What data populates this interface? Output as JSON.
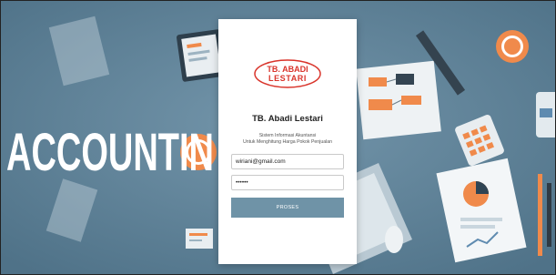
{
  "background": {
    "headline": "ACCOUNTIN",
    "colors": {
      "background": "#5f8399",
      "accent_orange": "#f08a4b"
    }
  },
  "logo": {
    "line1": "TB. ABADI",
    "line2": "LESTARI",
    "color": "#d9342b"
  },
  "login": {
    "title": "TB. Abadi Lestari",
    "subtitle_line1": "Sistem Informasi Akuntansi",
    "subtitle_line2": "Untuk Menghitung Harga Pokok Penjualan",
    "email_value": "wiriani@gmail.com",
    "password_value": "••••••",
    "submit_label": "PROSES"
  }
}
